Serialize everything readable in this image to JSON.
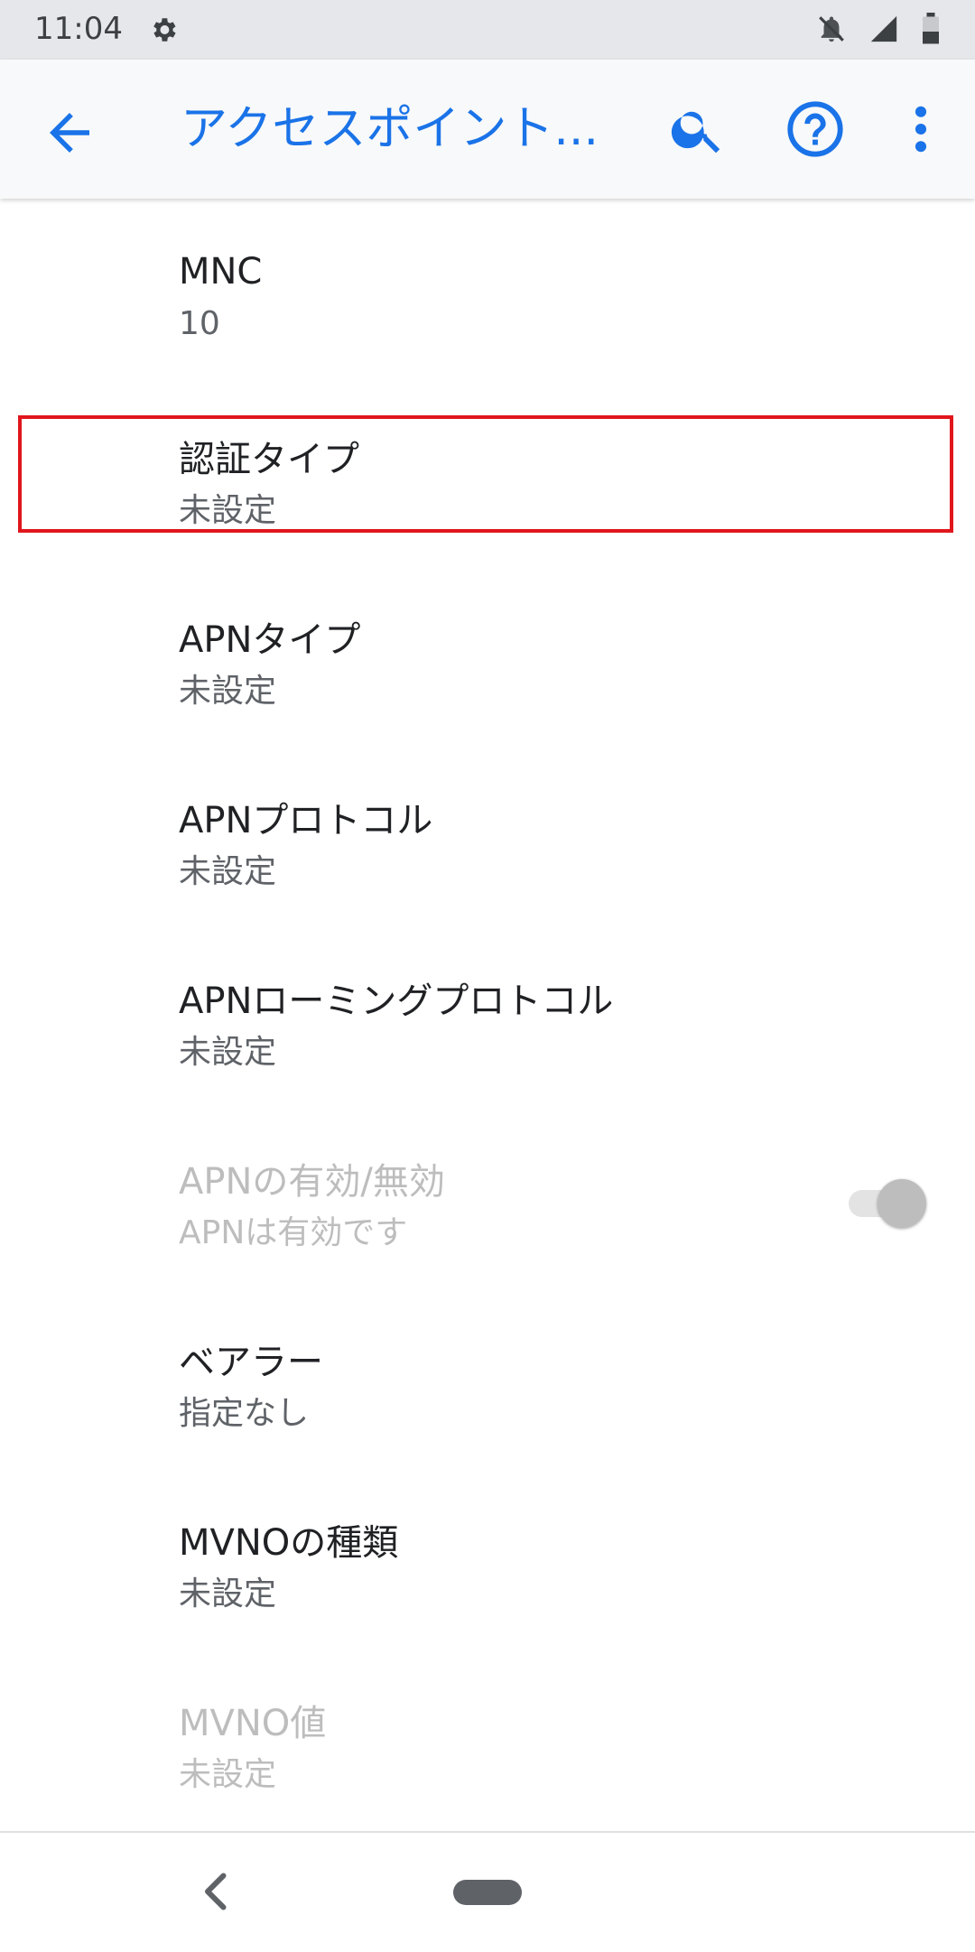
{
  "status_bar": {
    "time": "11:04",
    "icons": [
      "settings-icon",
      "notifications-off-icon",
      "signal-icon",
      "battery-icon"
    ]
  },
  "app_bar": {
    "title": "アクセスポイント...",
    "accent_color": "#1a73e8",
    "icons": [
      "back-arrow-icon",
      "search-icon",
      "help-icon",
      "more-vert-icon"
    ]
  },
  "settings": [
    {
      "title": "MNC",
      "summary": "10",
      "enabled": true
    },
    {
      "title": "認証タイプ",
      "summary": "未設定",
      "enabled": true,
      "highlighted": true
    },
    {
      "title": "APNタイプ",
      "summary": "未設定",
      "enabled": true
    },
    {
      "title": "APNプロトコル",
      "summary": "未設定",
      "enabled": true
    },
    {
      "title": "APNローミングプロトコル",
      "summary": "未設定",
      "enabled": true
    },
    {
      "title": "APNの有効/無効",
      "summary": "APNは有効です",
      "enabled": false,
      "switch_on": true
    },
    {
      "title": "ベアラー",
      "summary": "指定なし",
      "enabled": true
    },
    {
      "title": "MVNOの種類",
      "summary": "未設定",
      "enabled": true
    },
    {
      "title": "MVNO値",
      "summary": "未設定",
      "enabled": false
    }
  ],
  "highlight_color": "#e0161c",
  "nav_bar": {
    "icons": [
      "nav-back-icon",
      "home-pill-icon"
    ]
  }
}
